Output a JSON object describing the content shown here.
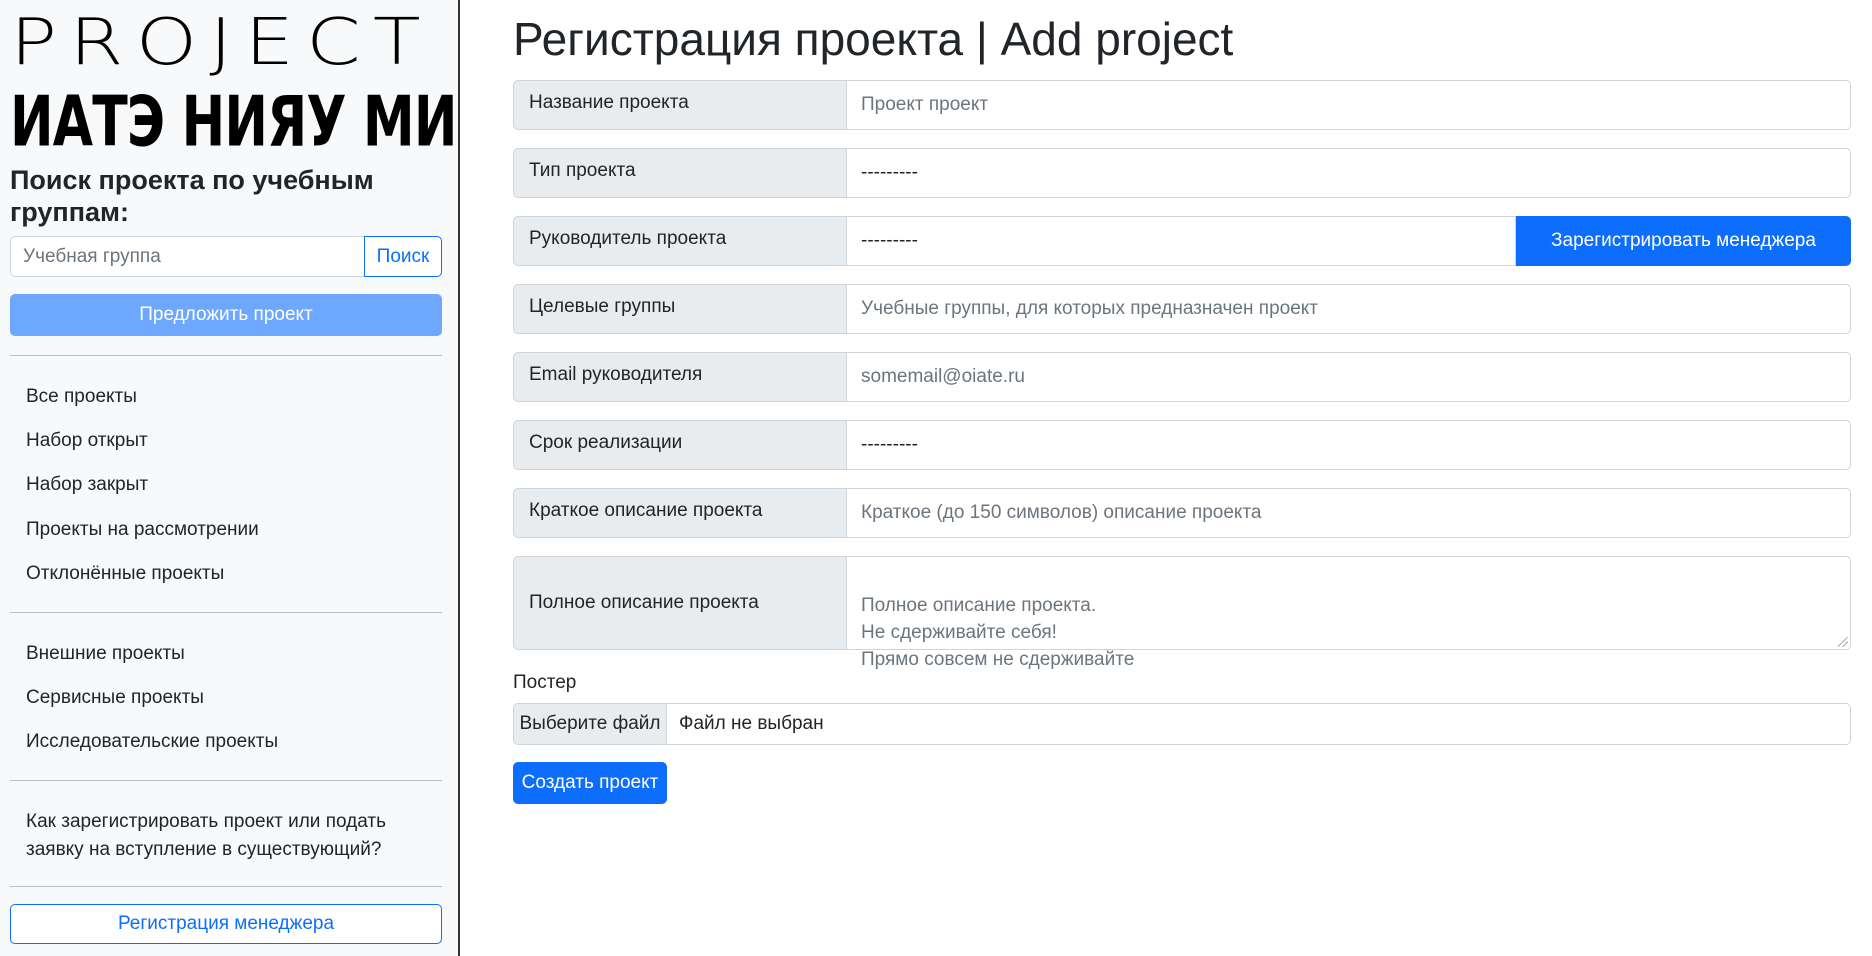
{
  "sidebar": {
    "logo_top": "PROJECT",
    "logo_bottom": "ИАТЭ НИЯУ МИФИ",
    "search_title": "Поиск проекта по учебным группам:",
    "search_placeholder": "Учебная группа",
    "search_button": "Поиск",
    "propose_button": "Предложить проект",
    "nav_primary": [
      "Все проекты",
      "Набор открыт",
      "Набор закрыт",
      "Проекты на рассмотрении",
      "Отклонённые проекты"
    ],
    "nav_secondary": [
      "Внешние проекты",
      "Сервисные проекты",
      "Исследовательские проекты"
    ],
    "help_link": "Как зарегистрировать проект или подать заявку на вступление в существующий?",
    "manager_button": "Регистрация менеджера"
  },
  "main": {
    "title": "Регистрация проекта | Add project",
    "fields": {
      "name": {
        "label": "Название проекта",
        "placeholder": "Проект проект"
      },
      "type": {
        "label": "Тип проекта",
        "value": "---------"
      },
      "leader": {
        "label": "Руководитель проекта",
        "value": "---------",
        "button": "Зарегистрировать менеджера"
      },
      "groups": {
        "label": "Целевые группы",
        "placeholder": "Учебные группы, для которых предназначен проект"
      },
      "email": {
        "label": "Email руководителя",
        "placeholder": "somemail@oiate.ru"
      },
      "deadline": {
        "label": "Срок реализации",
        "value": "---------"
      },
      "short_desc": {
        "label": "Краткое описание проекта",
        "placeholder": "Краткое (до 150 символов) описание проекта"
      },
      "full_desc": {
        "label": "Полное описание проекта",
        "placeholder": "Полное описание проекта.\nНе сдерживайте себя!\nПрямо совсем не сдерживайте"
      }
    },
    "poster": {
      "label": "Постер",
      "choose_button": "Выберите файл",
      "file_status": "Файл не выбран"
    },
    "submit_button": "Создать проект"
  },
  "colors": {
    "primary": "#0d6efd",
    "primary_light": "#6ea8fe",
    "label_bg": "#e9ecef",
    "sidebar_bg": "#f8f9fa"
  }
}
